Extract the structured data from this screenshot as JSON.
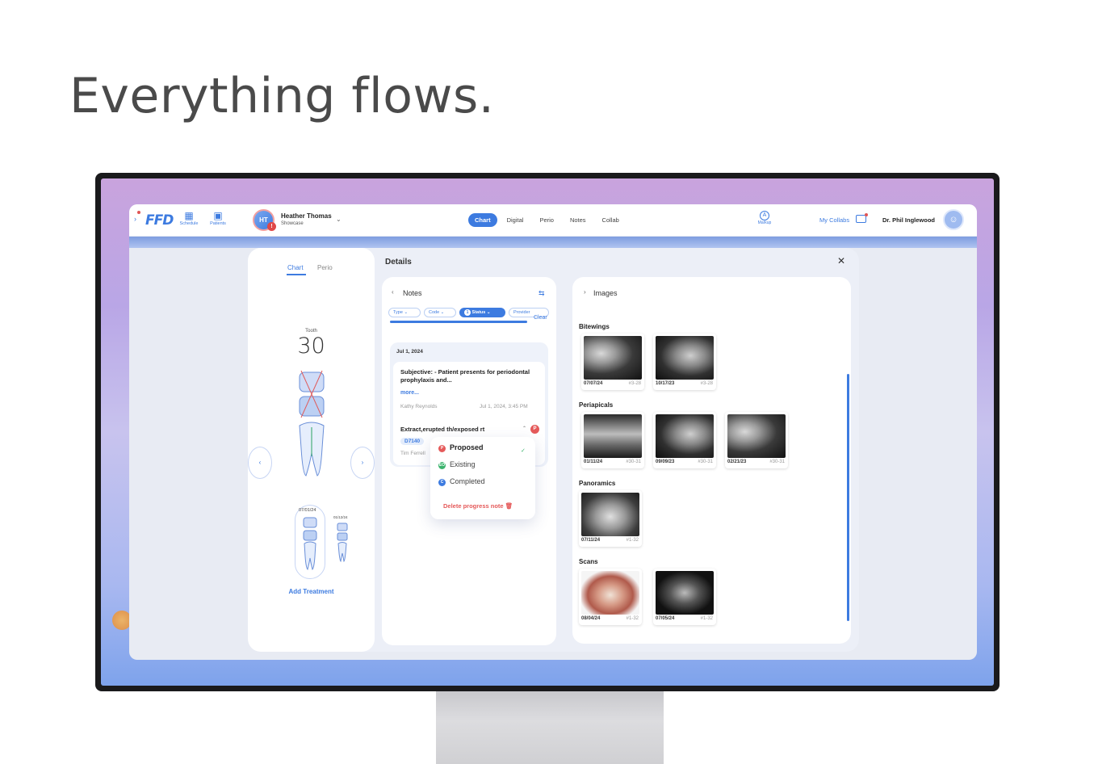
{
  "hero": {
    "title": "Everything flows."
  },
  "topbar": {
    "logo": "FFD",
    "nav": [
      {
        "label": "Schedule",
        "icon": "calendar-icon"
      },
      {
        "label": "Patients",
        "icon": "patient-icon"
      }
    ],
    "patient": {
      "initials": "HT",
      "name": "Heather Thomas",
      "subtitle": "Showcase",
      "alert": "!"
    },
    "tabs": [
      "Chart",
      "Digital",
      "Perio",
      "Notes",
      "Collab"
    ],
    "active_tab": "Chart",
    "markup_label": "Markup",
    "collabs_label": "My Collabs",
    "doctor_name": "Dr. Phil Inglewood"
  },
  "details": {
    "title": "Details",
    "close": "✕",
    "chart_panel": {
      "tabs": [
        "Chart",
        "Perio"
      ],
      "tooth_label": "Tooth",
      "tooth_number": "30",
      "history_dates": [
        "07/01/24",
        "01/12/24"
      ],
      "add_treatment": "Add Treatment"
    },
    "notes_panel": {
      "title": "Notes",
      "filters": [
        "Type",
        "Code",
        "Status",
        "Provider"
      ],
      "status_count": "1",
      "clear": "Clear",
      "note": {
        "date": "Jul 1, 2024",
        "subjective": "Subjective: - Patient presents for periodontal prophylaxis and...",
        "more": "more...",
        "author": "Kathy Reynolds",
        "timestamp": "Jul 1, 2024, 3:45 PM",
        "treatment_title": "Extract,erupted th/exposed rt",
        "treatment_code": "D7140",
        "treatment_author": "Tim Ferrell",
        "status_badge": "P"
      },
      "status_menu": {
        "options": [
          {
            "badge": "P",
            "label": "Proposed",
            "color": "#e55a5a"
          },
          {
            "badge": "EO",
            "label": "Existing",
            "color": "#3bb36d"
          },
          {
            "badge": "C",
            "label": "Completed",
            "color": "#3d7be0"
          }
        ],
        "selected": "Proposed",
        "delete_label": "Delete progress note"
      }
    },
    "images_panel": {
      "title": "Images",
      "sections": [
        {
          "title": "Bitewings",
          "items": [
            {
              "date": "07/07/24",
              "teeth": "#3-28"
            },
            {
              "date": "10/17/23",
              "teeth": "#3-28"
            }
          ]
        },
        {
          "title": "Periapicals",
          "items": [
            {
              "date": "01/11/24",
              "teeth": "#30-31"
            },
            {
              "date": "09/09/23",
              "teeth": "#30-31"
            },
            {
              "date": "02/21/23",
              "teeth": "#30-31"
            }
          ]
        },
        {
          "title": "Panoramics",
          "items": [
            {
              "date": "07/11/24",
              "teeth": "#1-32"
            }
          ]
        },
        {
          "title": "Scans",
          "items": [
            {
              "date": "08/04/24",
              "teeth": "#1-32"
            },
            {
              "date": "07/05/24",
              "teeth": "#1-32"
            }
          ]
        }
      ]
    }
  },
  "colors": {
    "accent": "#3d7be0",
    "danger": "#e55a5a",
    "success": "#3bb36d"
  }
}
